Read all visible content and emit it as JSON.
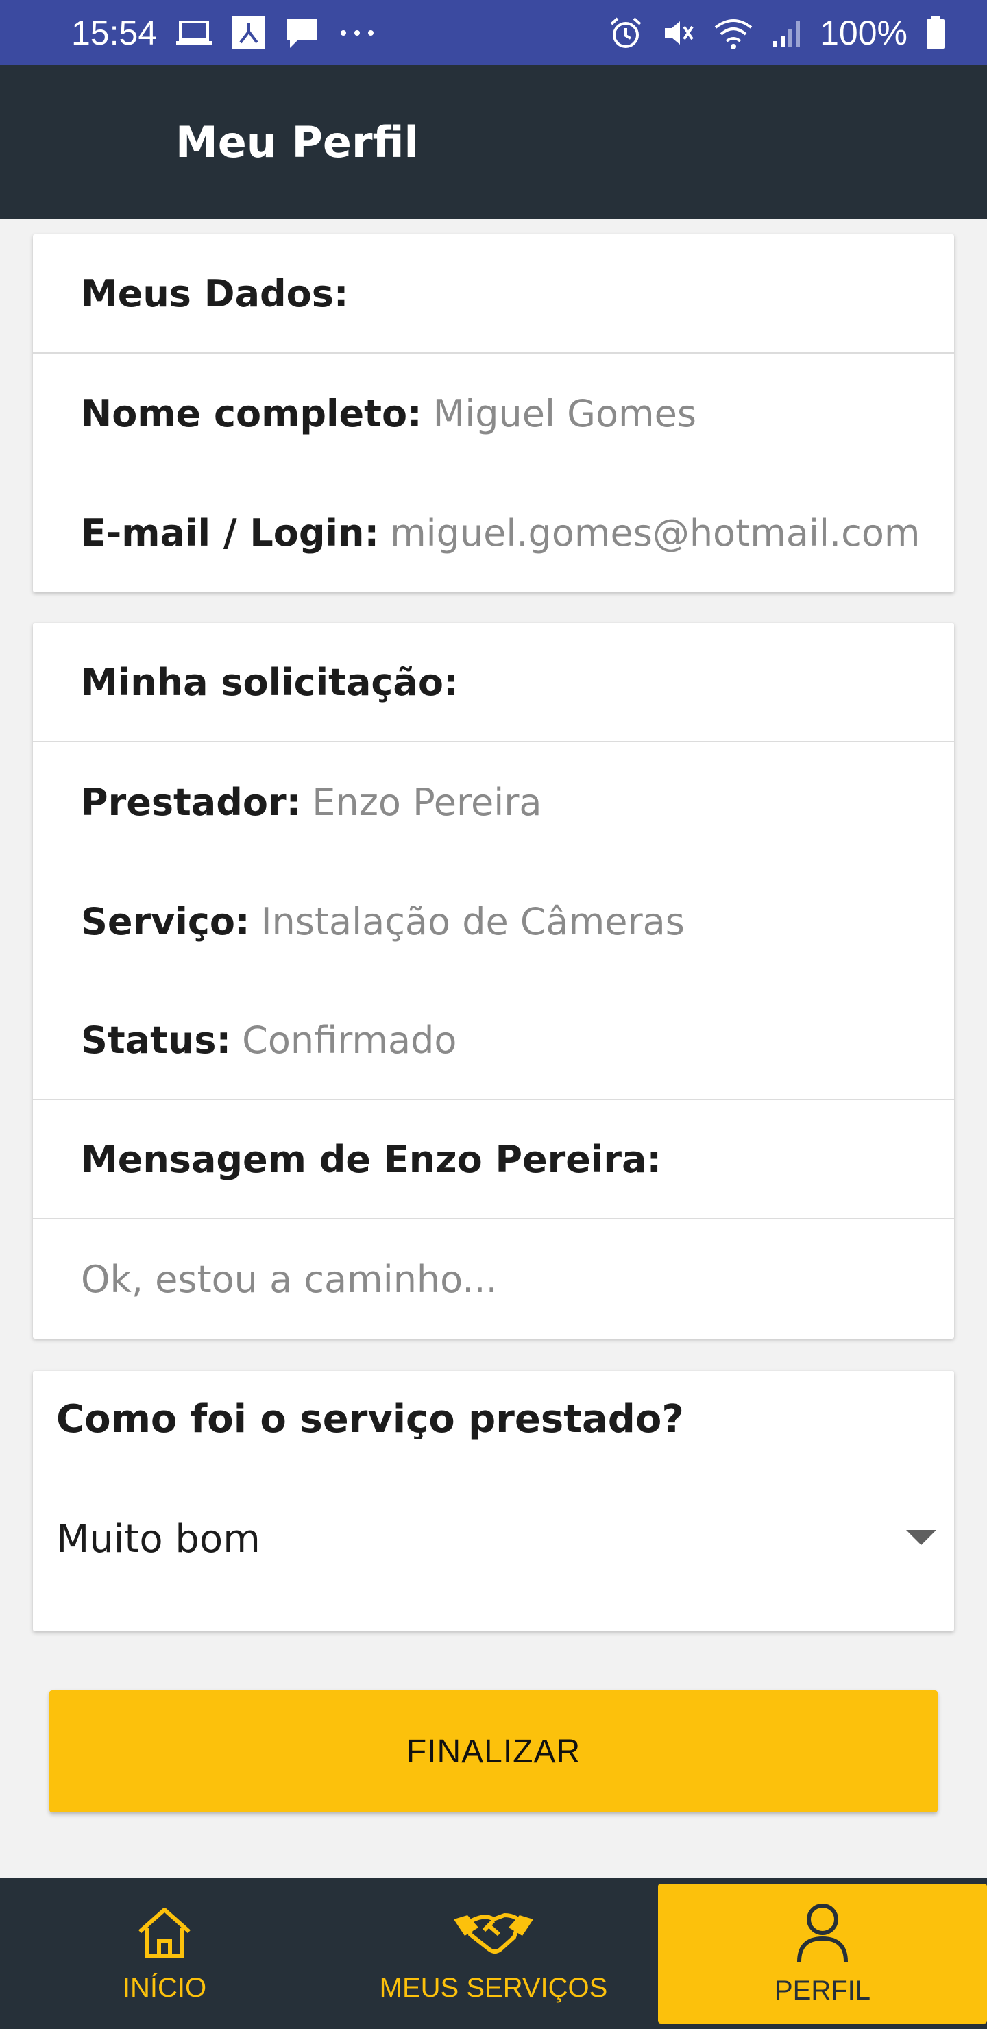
{
  "status_bar": {
    "time": "15:54",
    "battery": "100%",
    "left_icons": [
      "laptop-icon",
      "app-icon",
      "chat-icon",
      "more-dots-icon"
    ],
    "right_icons": [
      "alarm-icon",
      "mute-icon",
      "wifi-icon",
      "signal-icon",
      "battery-icon"
    ]
  },
  "app_bar": {
    "title": "Meu Perfil"
  },
  "my_data": {
    "header": "Meus Dados:",
    "name_label": "Nome completo:",
    "name_value": "Miguel Gomes",
    "email_label": "E-mail / Login:",
    "email_value": "miguel.gomes@hotmail.com"
  },
  "request": {
    "header": "Minha solicitação:",
    "provider_label": "Prestador:",
    "provider_value": "Enzo Pereira",
    "service_label": "Serviço:",
    "service_value": "Instalação de Câmeras",
    "status_label": "Status:",
    "status_value": "Confirmado",
    "message_header": "Mensagem de Enzo Pereira:",
    "message_text": "Ok, estou a caminho..."
  },
  "rating": {
    "question": "Como foi o serviço prestado?",
    "selected": "Muito bom"
  },
  "finish_button": "FINALIZAR",
  "bottom_nav": {
    "items": [
      {
        "label": "INÍCIO",
        "icon": "home-icon"
      },
      {
        "label": "MEUS SERVIÇOS",
        "icon": "handshake-icon"
      },
      {
        "label": "PERFIL",
        "icon": "person-icon",
        "active": true
      }
    ]
  },
  "colors": {
    "status_bar": "#3b4aa0",
    "app_bar": "#263039",
    "accent": "#fcc10c",
    "background": "#f2f2f2"
  }
}
